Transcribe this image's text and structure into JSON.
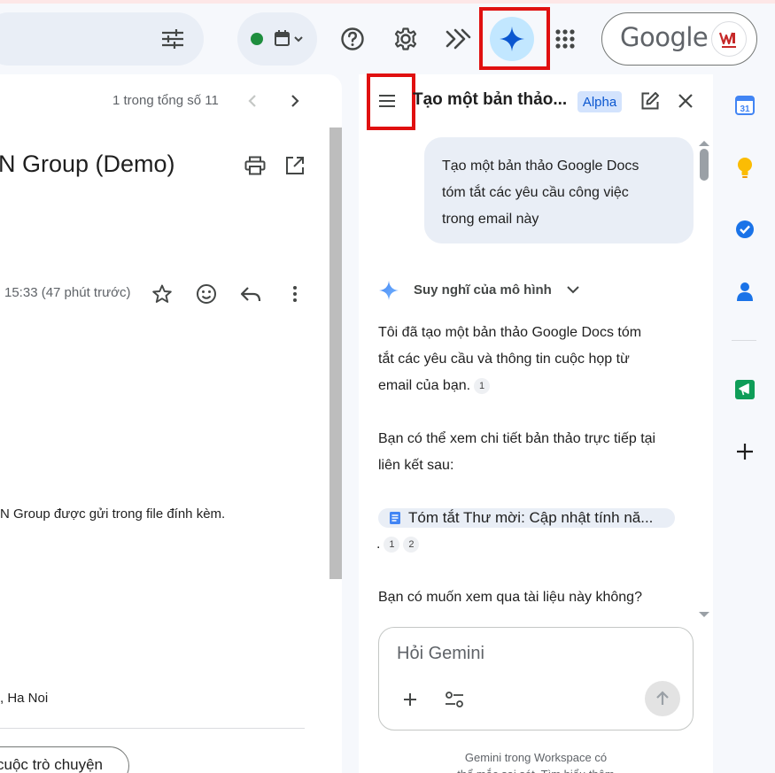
{
  "topbar": {
    "google_wordmark": "Google",
    "status_dot_color": "#1e8e3e",
    "gemini_active_bg": "#c2e7ff",
    "highlight_color": "#e01010"
  },
  "mail": {
    "pagination": "1 trong tổng số 11",
    "subject": "N Group (Demo)",
    "timestamp": "15:33 (47 phút trước)",
    "body_line": "N Group được gửi trong file đính kèm.",
    "signature_line": ", Ha Noi",
    "chat_button": "cuộc trò chuyện"
  },
  "gemini": {
    "title": "Tạo một bản thảo...",
    "badge": "Alpha",
    "user_prompt_lines": [
      "Tạo một bản thảo Google Docs",
      "tóm tắt các yêu cầu công việc",
      "trong email này"
    ],
    "thinking_label": "Suy nghĩ của mô hình",
    "response_1_lines": [
      "Tôi đã tạo một bản thảo Google Docs tóm",
      "tắt các yêu cầu và thông tin cuộc họp từ",
      "email của bạn."
    ],
    "citation_1": "1",
    "response_2_lines": [
      "Bạn có thể xem chi tiết bản thảo trực tiếp tại",
      "liên kết sau:"
    ],
    "doc_link": "Tóm tắt Thư mời: Cập nhật tính nă...",
    "trailing_dot": ".",
    "citation_a": "1",
    "citation_b": "2",
    "question": "Bạn có muốn xem qua tài liệu này không?",
    "input_placeholder": "Hỏi Gemini",
    "footer_line_1": "Gemini trong Workspace có",
    "footer_line_2": "thể mắc sai sót. Tìm hiểu thêm"
  },
  "rail": {
    "calendar_day": "31"
  }
}
